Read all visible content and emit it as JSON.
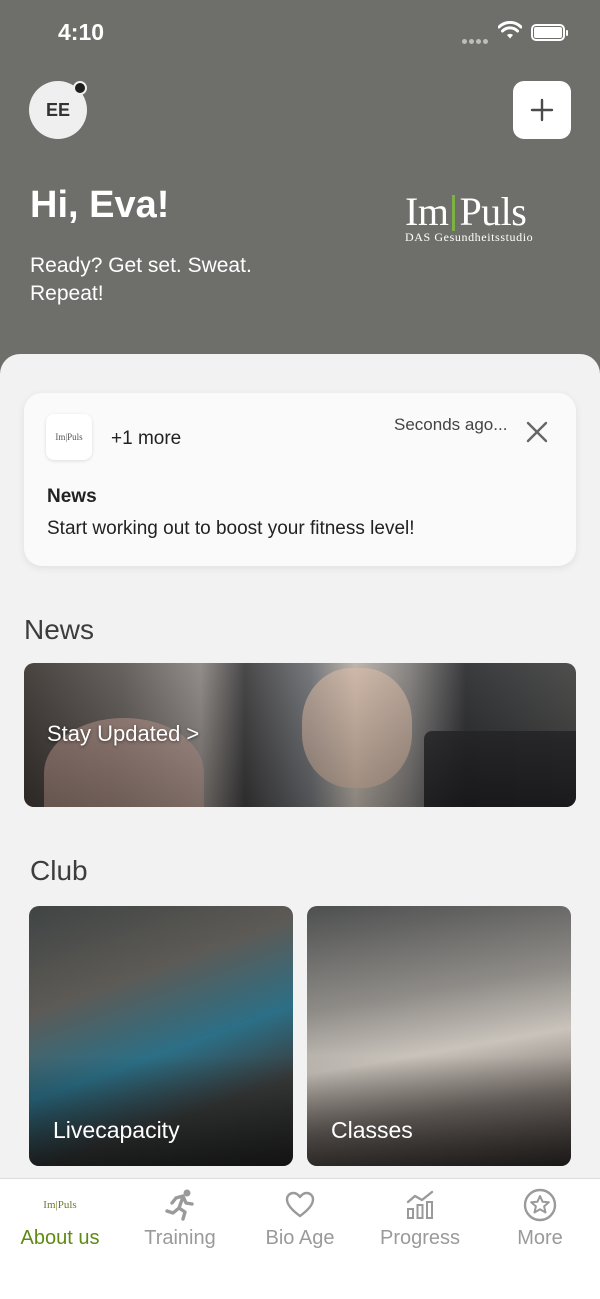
{
  "status_bar": {
    "time": "4:10"
  },
  "header": {
    "avatar_initials": "EE",
    "greeting": "Hi, Eva!",
    "subtitle": "Ready? Get set. Sweat. Repeat!",
    "logo": {
      "left": "Im",
      "right": "Puls",
      "tagline": "DAS Gesundheitsstudio"
    },
    "add_icon": "plus-icon"
  },
  "notification": {
    "more": "+1 more",
    "time": "Seconds ago...",
    "title": "News",
    "body": "Start working out to boost your fitness level!",
    "logo_text": "Im|Puls"
  },
  "news": {
    "section_title": "News",
    "banner_link": "Stay Updated >"
  },
  "club": {
    "section_title": "Club",
    "cards": [
      {
        "label": "Livecapacity"
      },
      {
        "label": "Classes"
      }
    ]
  },
  "tabbar": {
    "active": "About us",
    "tabs": [
      {
        "label": "About us",
        "icon": "impuls-logo-icon"
      },
      {
        "label": "Training",
        "icon": "runner-icon"
      },
      {
        "label": "Bio Age",
        "icon": "heart-icon"
      },
      {
        "label": "Progress",
        "icon": "chart-icon"
      },
      {
        "label": "More",
        "icon": "star-circle-icon"
      }
    ]
  },
  "colors": {
    "header_bg": "#6e6e6a",
    "accent_green": "#5e8a14",
    "logo_bar_green": "#7bb243"
  }
}
